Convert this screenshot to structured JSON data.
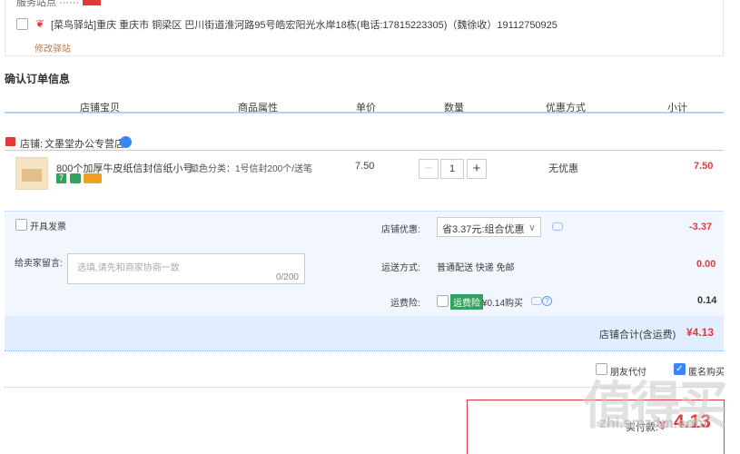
{
  "address": {
    "partial_top_text": "服务站点 ······",
    "text": "[菜鸟驿站]重庆 重庆市 铜梁区 巴川街道淮河路95号皓宏阳光水岸18栋(电话:17815223305)（魏徐收）19112750925",
    "modify_link": "修改驿站"
  },
  "order": {
    "section_title": "确认订单信息",
    "columns": [
      "店铺宝贝",
      "商品属性",
      "单价",
      "数量",
      "优惠方式",
      "小计"
    ],
    "store_label": "店铺:",
    "store_name": "文墨堂办公专营店",
    "item": {
      "title": "800个加厚牛皮纸信封信纸小号...",
      "attributes": "颜色分类：1号信封200个/送笔",
      "unit_price": "7.50",
      "quantity": "1",
      "discount": "无优惠",
      "subtotal": "7.50",
      "badge_7": "7"
    }
  },
  "extras": {
    "invoice_label": "开具发票",
    "store_discount_label": "店铺优惠:",
    "store_discount_value": "省3.37元:组合优惠",
    "store_discount_amount": "-3.37",
    "message_label": "给卖家留言:",
    "message_placeholder": "选填,请先和商家协商一致",
    "message_count": "0/200",
    "shipping_label": "运送方式:",
    "shipping_value": "普通配送 快递 免邮",
    "shipping_amount": "0.00",
    "insurance_label": "运费险:",
    "insurance_tag": "运费险",
    "insurance_value": "¥0.14购买",
    "insurance_amount": "0.14",
    "store_total_label": "店铺合计(含运费)",
    "store_total_value": "¥4.13"
  },
  "footer": {
    "friend_pay_label": "朋友代付",
    "anonymous_label": "匿名购买",
    "actual_pay_label": "实付款:",
    "actual_pay_currency": "¥",
    "actual_pay_value": "4.13",
    "watermark": "值得买",
    "watermark_site": "zhi.smzdm.com"
  },
  "colors": {
    "accent_red": "#e4393c",
    "accent_blue": "#b2d1ff",
    "area_blue": "#f2f7ff"
  }
}
